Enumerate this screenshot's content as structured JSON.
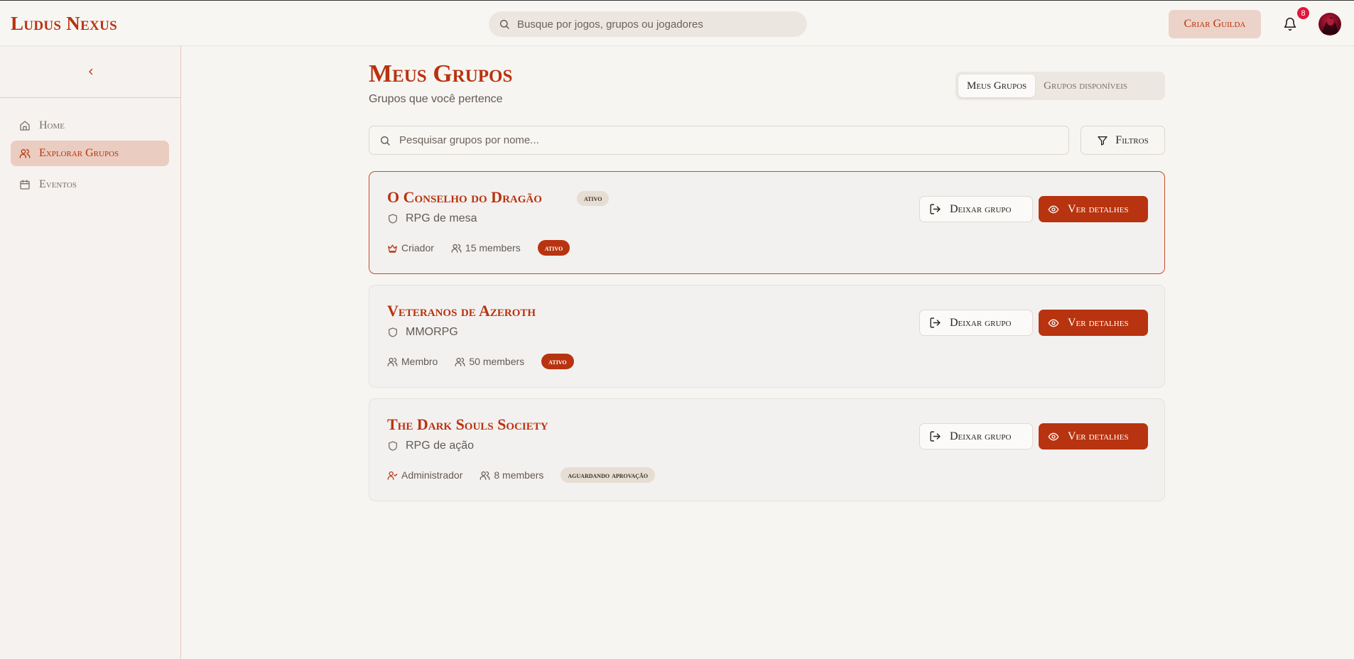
{
  "app": {
    "logo": "Ludus Nexus",
    "search_placeholder": "Busque por jogos, grupos ou jogadores",
    "create_guild_label": "Criar Guilda",
    "notification_count": "8"
  },
  "sidebar": {
    "items": [
      {
        "label": "Home",
        "icon": "home-icon",
        "active": false
      },
      {
        "label": "Explorar Grupos",
        "icon": "users-icon",
        "active": true
      },
      {
        "label": "Eventos",
        "icon": "calendar-icon",
        "active": false
      }
    ]
  },
  "main": {
    "title": "Meus Grupos",
    "subtitle": "Grupos que você pertence",
    "tabs": [
      {
        "label": "Meus Grupos",
        "selected": true
      },
      {
        "label": "Grupos disponíveis",
        "selected": false
      }
    ],
    "search_placeholder": "Pesquisar grupos por nome...",
    "filters_label": "Filtros",
    "leave_label": "Deixar grupo",
    "details_label": "Ver detalhes",
    "groups": [
      {
        "name": "O Conselho do Dragão",
        "title_badge": "ativo",
        "genre": "RPG de mesa",
        "role": "Criador",
        "role_icon": "crown-icon",
        "members": "15 members",
        "status": "ativo"
      },
      {
        "name": "Veteranos de Azeroth",
        "title_badge": "",
        "genre": "MMORPG",
        "role": "Membro",
        "role_icon": "users-icon",
        "members": "50 members",
        "status": "ativo"
      },
      {
        "name": "The Dark Souls Society",
        "title_badge": "",
        "genre": "RPG de ação",
        "role": "Administrador",
        "role_icon": "user-check-icon",
        "members": "8 members",
        "status": "aguardando aprovação"
      }
    ]
  },
  "colors": {
    "accent": "#b8330f",
    "background": "#f7f5f2",
    "badge": "#e0183b"
  }
}
